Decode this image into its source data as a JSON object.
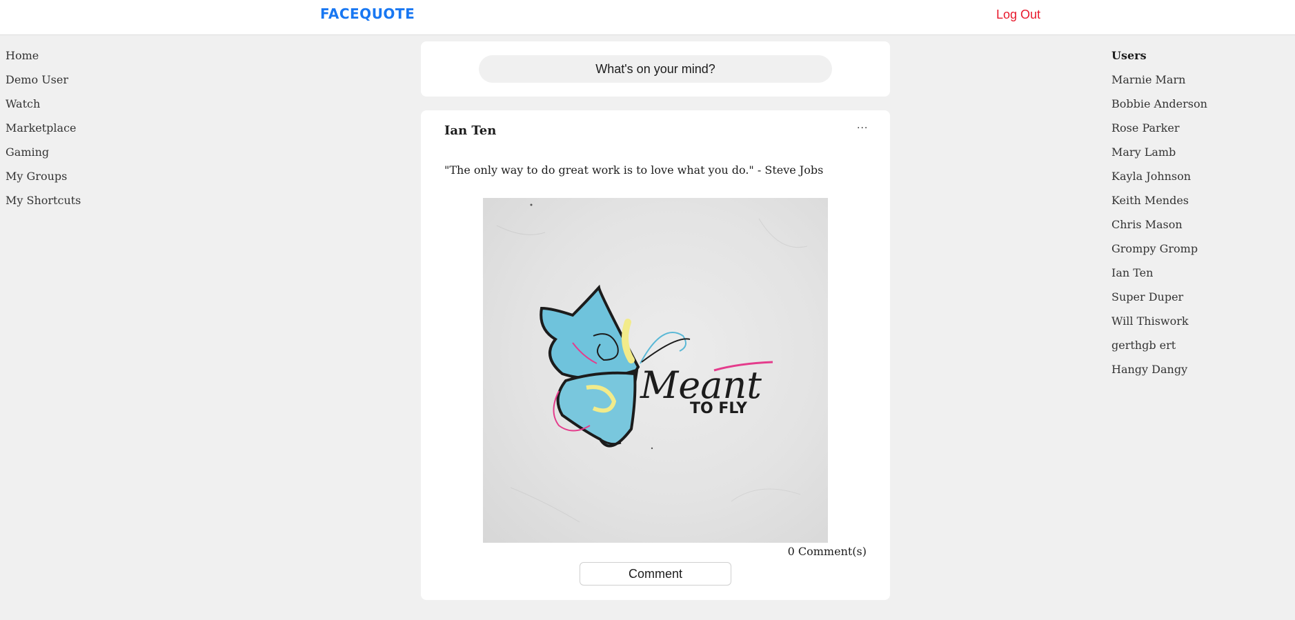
{
  "header": {
    "brand": "FACEQUOTE",
    "logout_label": "Log Out"
  },
  "left_nav": {
    "items": [
      {
        "label": "Home"
      },
      {
        "label": "Demo User"
      },
      {
        "label": "Watch"
      },
      {
        "label": "Marketplace"
      },
      {
        "label": "Gaming"
      },
      {
        "label": "My Groups"
      },
      {
        "label": "My Shortcuts"
      }
    ]
  },
  "composer": {
    "placeholder": "What's on your mind?"
  },
  "post": {
    "author": "Ian Ten",
    "more_label": "...",
    "quote": "\"The only way to do great work is to love what you do.\" - Steve Jobs",
    "image": {
      "title_word": "Meant",
      "subtitle_word": "TO FLY"
    },
    "comment_count": "0 Comment(s)",
    "comment_button": "Comment"
  },
  "users": {
    "heading": "Users",
    "items": [
      {
        "label": "Marnie Marn"
      },
      {
        "label": "Bobbie Anderson"
      },
      {
        "label": "Rose Parker"
      },
      {
        "label": "Mary Lamb"
      },
      {
        "label": "Kayla Johnson"
      },
      {
        "label": "Keith Mendes"
      },
      {
        "label": "Chris Mason"
      },
      {
        "label": "Grompy Gromp"
      },
      {
        "label": "Ian Ten"
      },
      {
        "label": "Super Duper"
      },
      {
        "label": "Will Thiswork"
      },
      {
        "label": "gerthgb ert"
      },
      {
        "label": "Hangy Dangy"
      }
    ]
  },
  "colors": {
    "brand": "#1877f2",
    "logout": "#e8192c",
    "background": "#f0f0f0"
  }
}
